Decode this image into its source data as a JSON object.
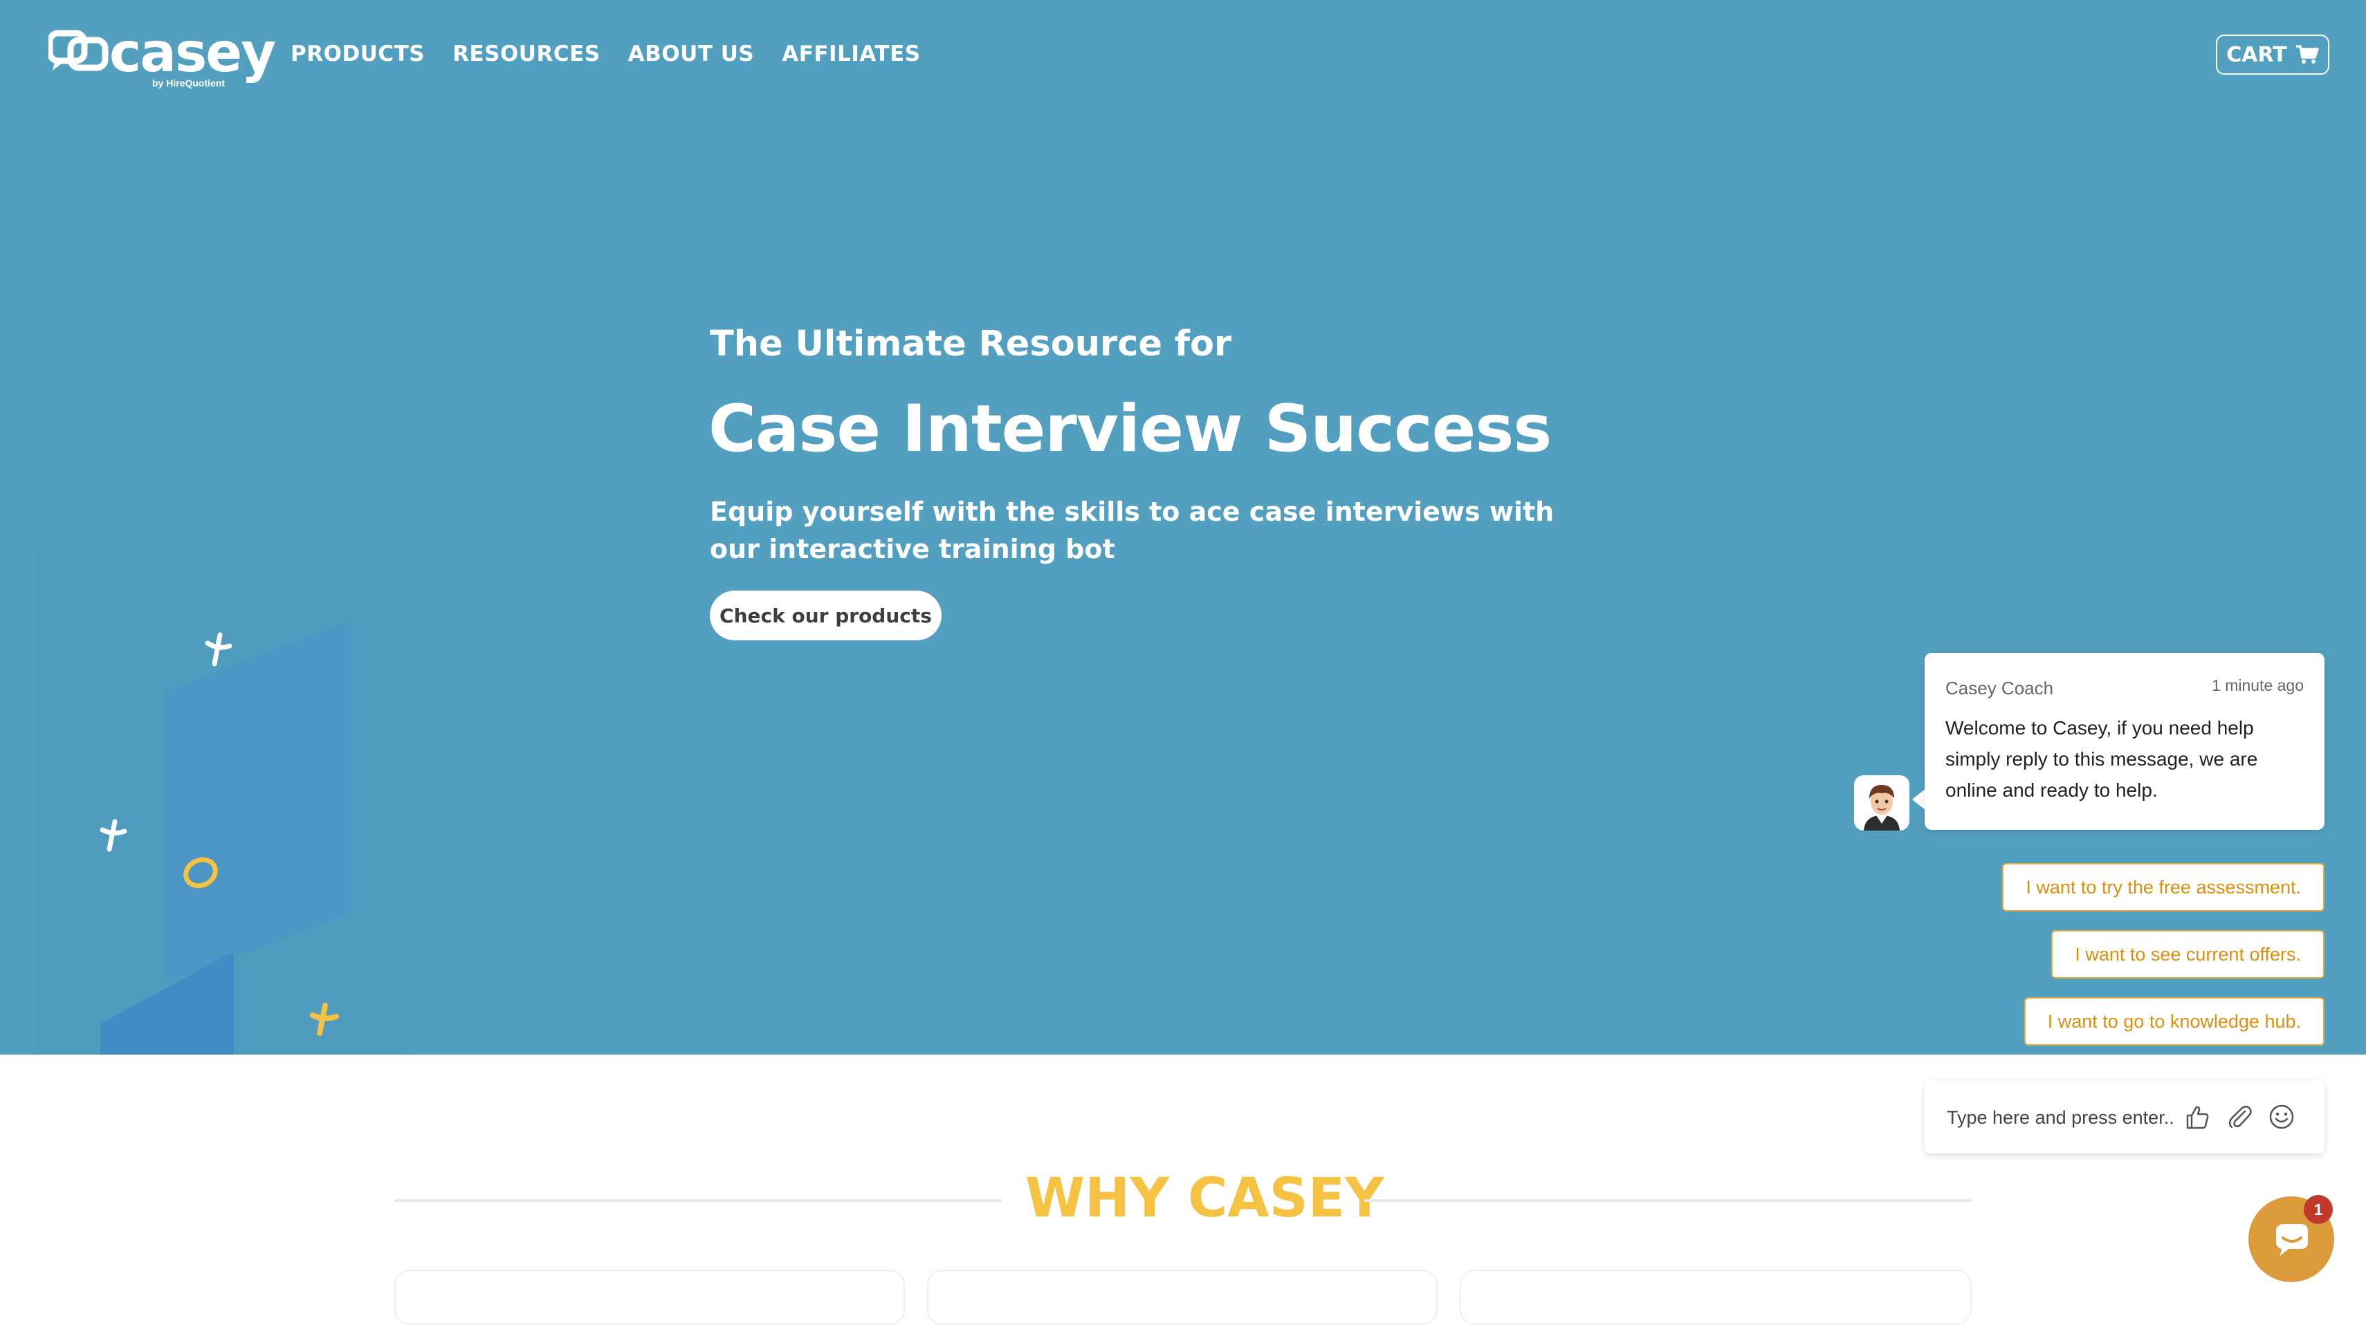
{
  "header": {
    "logo_text": "casey",
    "logo_sub": "by HireQuotient",
    "nav": [
      "PRODUCTS",
      "RESOURCES",
      "ABOUT US",
      "AFFILIATES"
    ],
    "cart_label": "CART"
  },
  "hero": {
    "kicker": "The Ultimate Resource for",
    "headline": "Case Interview Success",
    "subline": "Equip yourself with the skills to ace case interviews with our interactive training bot",
    "cta": "Check our products"
  },
  "chat": {
    "sender": "Casey Coach",
    "time": "1 minute ago",
    "message": "Welcome to Casey, if you need help simply reply to this message, we are online and ready to help.",
    "quick_replies": [
      "I want to try the free assessment.",
      "I want to see current offers.",
      "I want to go to knowledge hub."
    ],
    "input_placeholder": "Type here and press enter..",
    "badge_count": "1"
  },
  "why": {
    "title": "WHY CASEY"
  },
  "colors": {
    "hero_bg": "#529fbf",
    "accent_yellow": "#f5c242",
    "reply_orange": "#de8f0e",
    "launcher": "#dc9b3a"
  }
}
